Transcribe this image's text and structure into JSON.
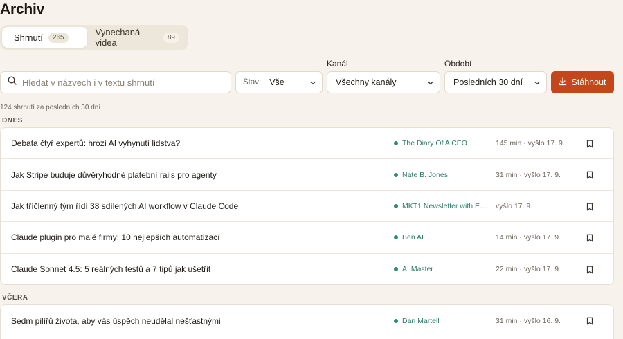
{
  "page": {
    "title": "Archiv"
  },
  "tabs": [
    {
      "label": "Shrnutí",
      "count": "265",
      "active": true
    },
    {
      "label": "Vynechaná videa",
      "count": "89",
      "active": false
    }
  ],
  "filters": {
    "search_placeholder": "Hledat v názvech i v textu shrnutí",
    "status_prefix": "Stav:",
    "status_value": "Vše",
    "channel_label": "Kanál",
    "channel_value": "Všechny kanály",
    "period_label": "Období",
    "period_value": "Posledních 30 dní",
    "download_label": "Stáhnout"
  },
  "summary_count": "124 shrnutí za posledních 30 dní",
  "groups": [
    {
      "label": "DNES",
      "items": [
        {
          "title": "Debata čtyř expertů: hrozí AI vyhynutí lidstva?",
          "channel": "The Diary Of A CEO",
          "meta": "145 min · vyšlo 17. 9."
        },
        {
          "title": "Jak Stripe buduje důvěryhodné platební rails pro agenty",
          "channel": "Nate B. Jones",
          "meta": "31 min · vyšlo 17. 9."
        },
        {
          "title": "Jak tříčlenný tým řídí 38 sdílených AI workflow v Claude Code",
          "channel": "MKT1 Newsletter with Em…",
          "meta": "vyšlo 17. 9."
        },
        {
          "title": "Claude plugin pro malé firmy: 10 nejlepších automatizací",
          "channel": "Ben AI",
          "meta": "14 min · vyšlo 17. 9."
        },
        {
          "title": "Claude Sonnet 4.5: 5 reálných testů a 7 tipů jak ušetřit",
          "channel": "AI Master",
          "meta": "22 min · vyšlo 17. 9."
        }
      ]
    },
    {
      "label": "VČERA",
      "items": [
        {
          "title": "Sedm pilířů života, aby vás úspěch neudělal nešťastnými",
          "channel": "Dan Martell",
          "meta": "31 min · vyšlo 16. 9."
        }
      ]
    }
  ],
  "icons": {
    "search": "search-icon",
    "chevron": "chevron-down-icon",
    "download": "download-icon",
    "bookmark": "bookmark-icon"
  },
  "colors": {
    "accent": "#c6461b",
    "channel": "#2e7d6b",
    "background": "#f7f3ec"
  }
}
